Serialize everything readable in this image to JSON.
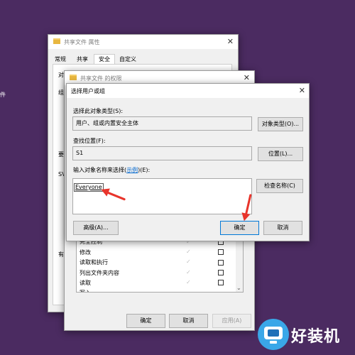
{
  "desktop": {
    "side_char": "件"
  },
  "properties_window": {
    "title": "共享文件 属性",
    "tabs": [
      "常规",
      "共享",
      "安全",
      "自定义"
    ],
    "active_tab_index": 2,
    "partial_labels": [
      "对",
      "组",
      "要",
      "SV",
      "有"
    ]
  },
  "permissions_window": {
    "title": "共享文件 的权限",
    "permissions": [
      "完全控制",
      "修改",
      "读取和执行",
      "列出文件夹内容",
      "读取",
      "写入"
    ],
    "buttons": {
      "ok": "确定",
      "cancel": "取消",
      "apply": "应用(A)"
    }
  },
  "select_dialog": {
    "title": "选择用户或组",
    "object_type_label": "选择此对象类型(S):",
    "object_type_value": "用户、组或内置安全主体",
    "object_type_button": "对象类型(O)...",
    "location_label": "查找位置(F):",
    "location_value": "S1",
    "location_button": "位置(L)...",
    "names_label_prefix": "输入对象名称来选择(",
    "names_label_link": "示例",
    "names_label_suffix": ")(E):",
    "names_value": "Everyone",
    "check_names_button": "检查名称(C)",
    "advanced_button": "高级(A)...",
    "ok_button": "确定",
    "cancel_button": "取消"
  },
  "watermark": {
    "text": "好装机"
  },
  "colors": {
    "desktop": "#4b2b61",
    "arrow": "#e8342b",
    "link": "#0066cc"
  }
}
